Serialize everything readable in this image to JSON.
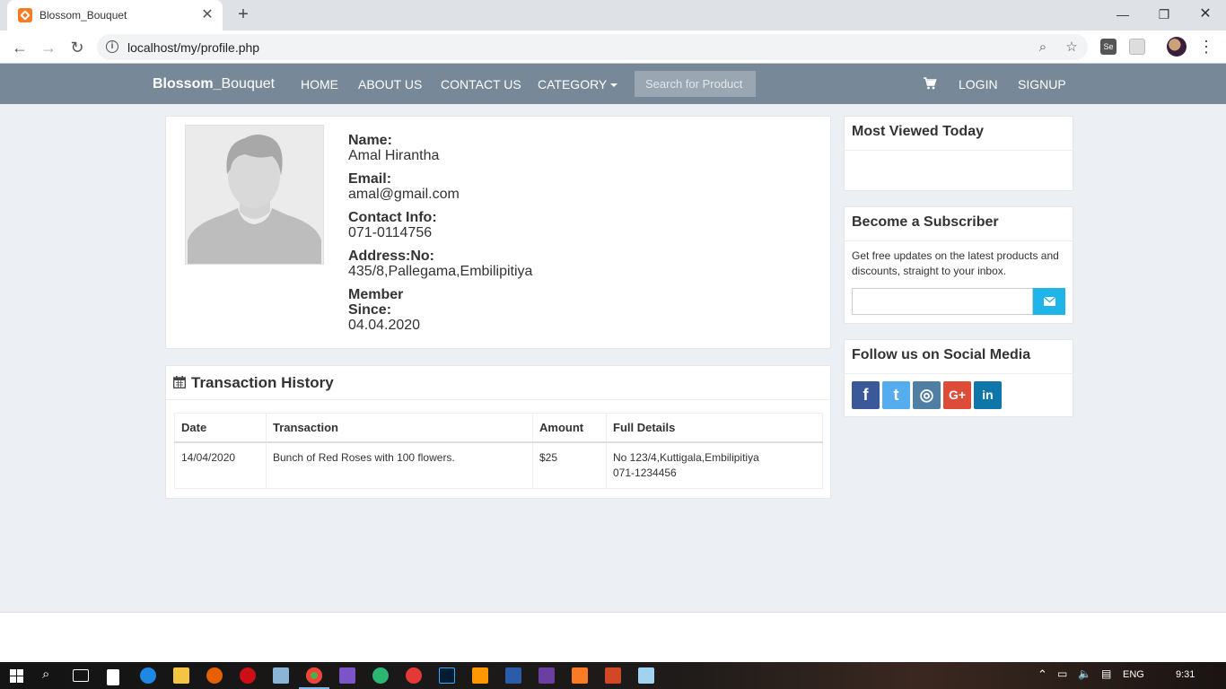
{
  "browser": {
    "tab_title": "Blossom_Bouquet",
    "url": "localhost/my/profile.php",
    "window_controls": [
      "minimize",
      "maximize",
      "close"
    ]
  },
  "site": {
    "brand_bold": "Blossom_",
    "brand_rest": "Bouquet",
    "nav": {
      "home": "HOME",
      "about": "ABOUT US",
      "contact": "CONTACT US",
      "category": "CATEGORY",
      "search_placeholder": "Search for Product",
      "login": "LOGIN",
      "signup": "SIGNUP"
    }
  },
  "profile": {
    "name_label": "Name:",
    "name": "Amal Hirantha",
    "email_label": "Email:",
    "email": "amal@gmail.com",
    "contact_label": "Contact Info:",
    "contact": "071-0114756",
    "address_label": "Address:No:",
    "address": "435/8,Pallegama,Embilipitiya",
    "member_label_1": "Member",
    "member_label_2": "Since:",
    "member_since": "04.04.2020"
  },
  "transactions": {
    "title": "Transaction History",
    "headers": [
      "Date",
      "Transaction",
      "Amount",
      "Full Details"
    ],
    "rows": [
      {
        "date": "14/04/2020",
        "transaction": "Bunch of Red Roses with 100 flowers.",
        "amount": "$25",
        "details_line1": "No 123/4,Kuttigala,Embilipitiya",
        "details_line2": "071-1234456"
      }
    ]
  },
  "sidebar": {
    "most_viewed_title": "Most Viewed Today",
    "subscriber_title": "Become a Subscriber",
    "subscriber_text": "Get free updates on the latest products and discounts, straight to your inbox.",
    "social_title": "Follow us on Social Media",
    "social": [
      {
        "name": "facebook",
        "glyph": "f",
        "color": "#3b5998"
      },
      {
        "name": "twitter",
        "glyph": "t",
        "color": "#55acee"
      },
      {
        "name": "instagram",
        "glyph": "◎",
        "color": "#517fa4"
      },
      {
        "name": "google-plus",
        "glyph": "G+",
        "color": "#dd4b39"
      },
      {
        "name": "linkedin",
        "glyph": "in",
        "color": "#0e76a8"
      }
    ]
  },
  "taskbar": {
    "language": "ENG",
    "time": "9:31"
  }
}
